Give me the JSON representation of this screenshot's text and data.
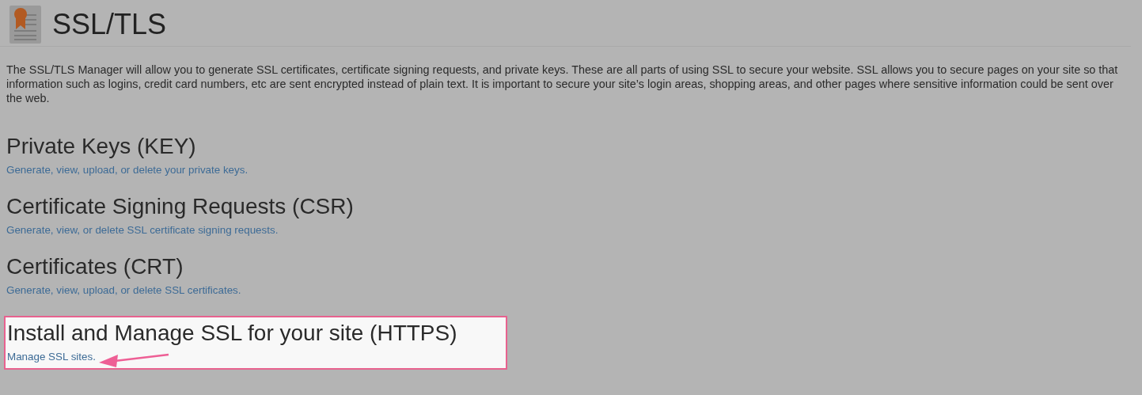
{
  "page": {
    "title": "SSL/TLS",
    "description": "The SSL/TLS Manager will allow you to generate SSL certificates, certificate signing requests, and private keys. These are all parts of using SSL to secure your website. SSL allows you to secure pages on your site so that information such as logins, credit card numbers, etc are sent encrypted instead of plain text. It is important to secure your site’s login areas, shopping areas, and other pages where sensitive information could be sent over the web."
  },
  "sections": [
    {
      "heading": "Private Keys (KEY)",
      "link": "Generate, view, upload, or delete your private keys.",
      "highlighted": false
    },
    {
      "heading": "Certificate Signing Requests (CSR)",
      "link": "Generate, view, or delete SSL certificate signing requests.",
      "highlighted": false
    },
    {
      "heading": "Certificates (CRT)",
      "link": "Generate, view, upload, or delete SSL certificates.",
      "highlighted": false
    },
    {
      "heading": "Install and Manage SSL for your site (HTTPS)",
      "link": "Manage SSL sites.",
      "highlighted": true
    }
  ]
}
